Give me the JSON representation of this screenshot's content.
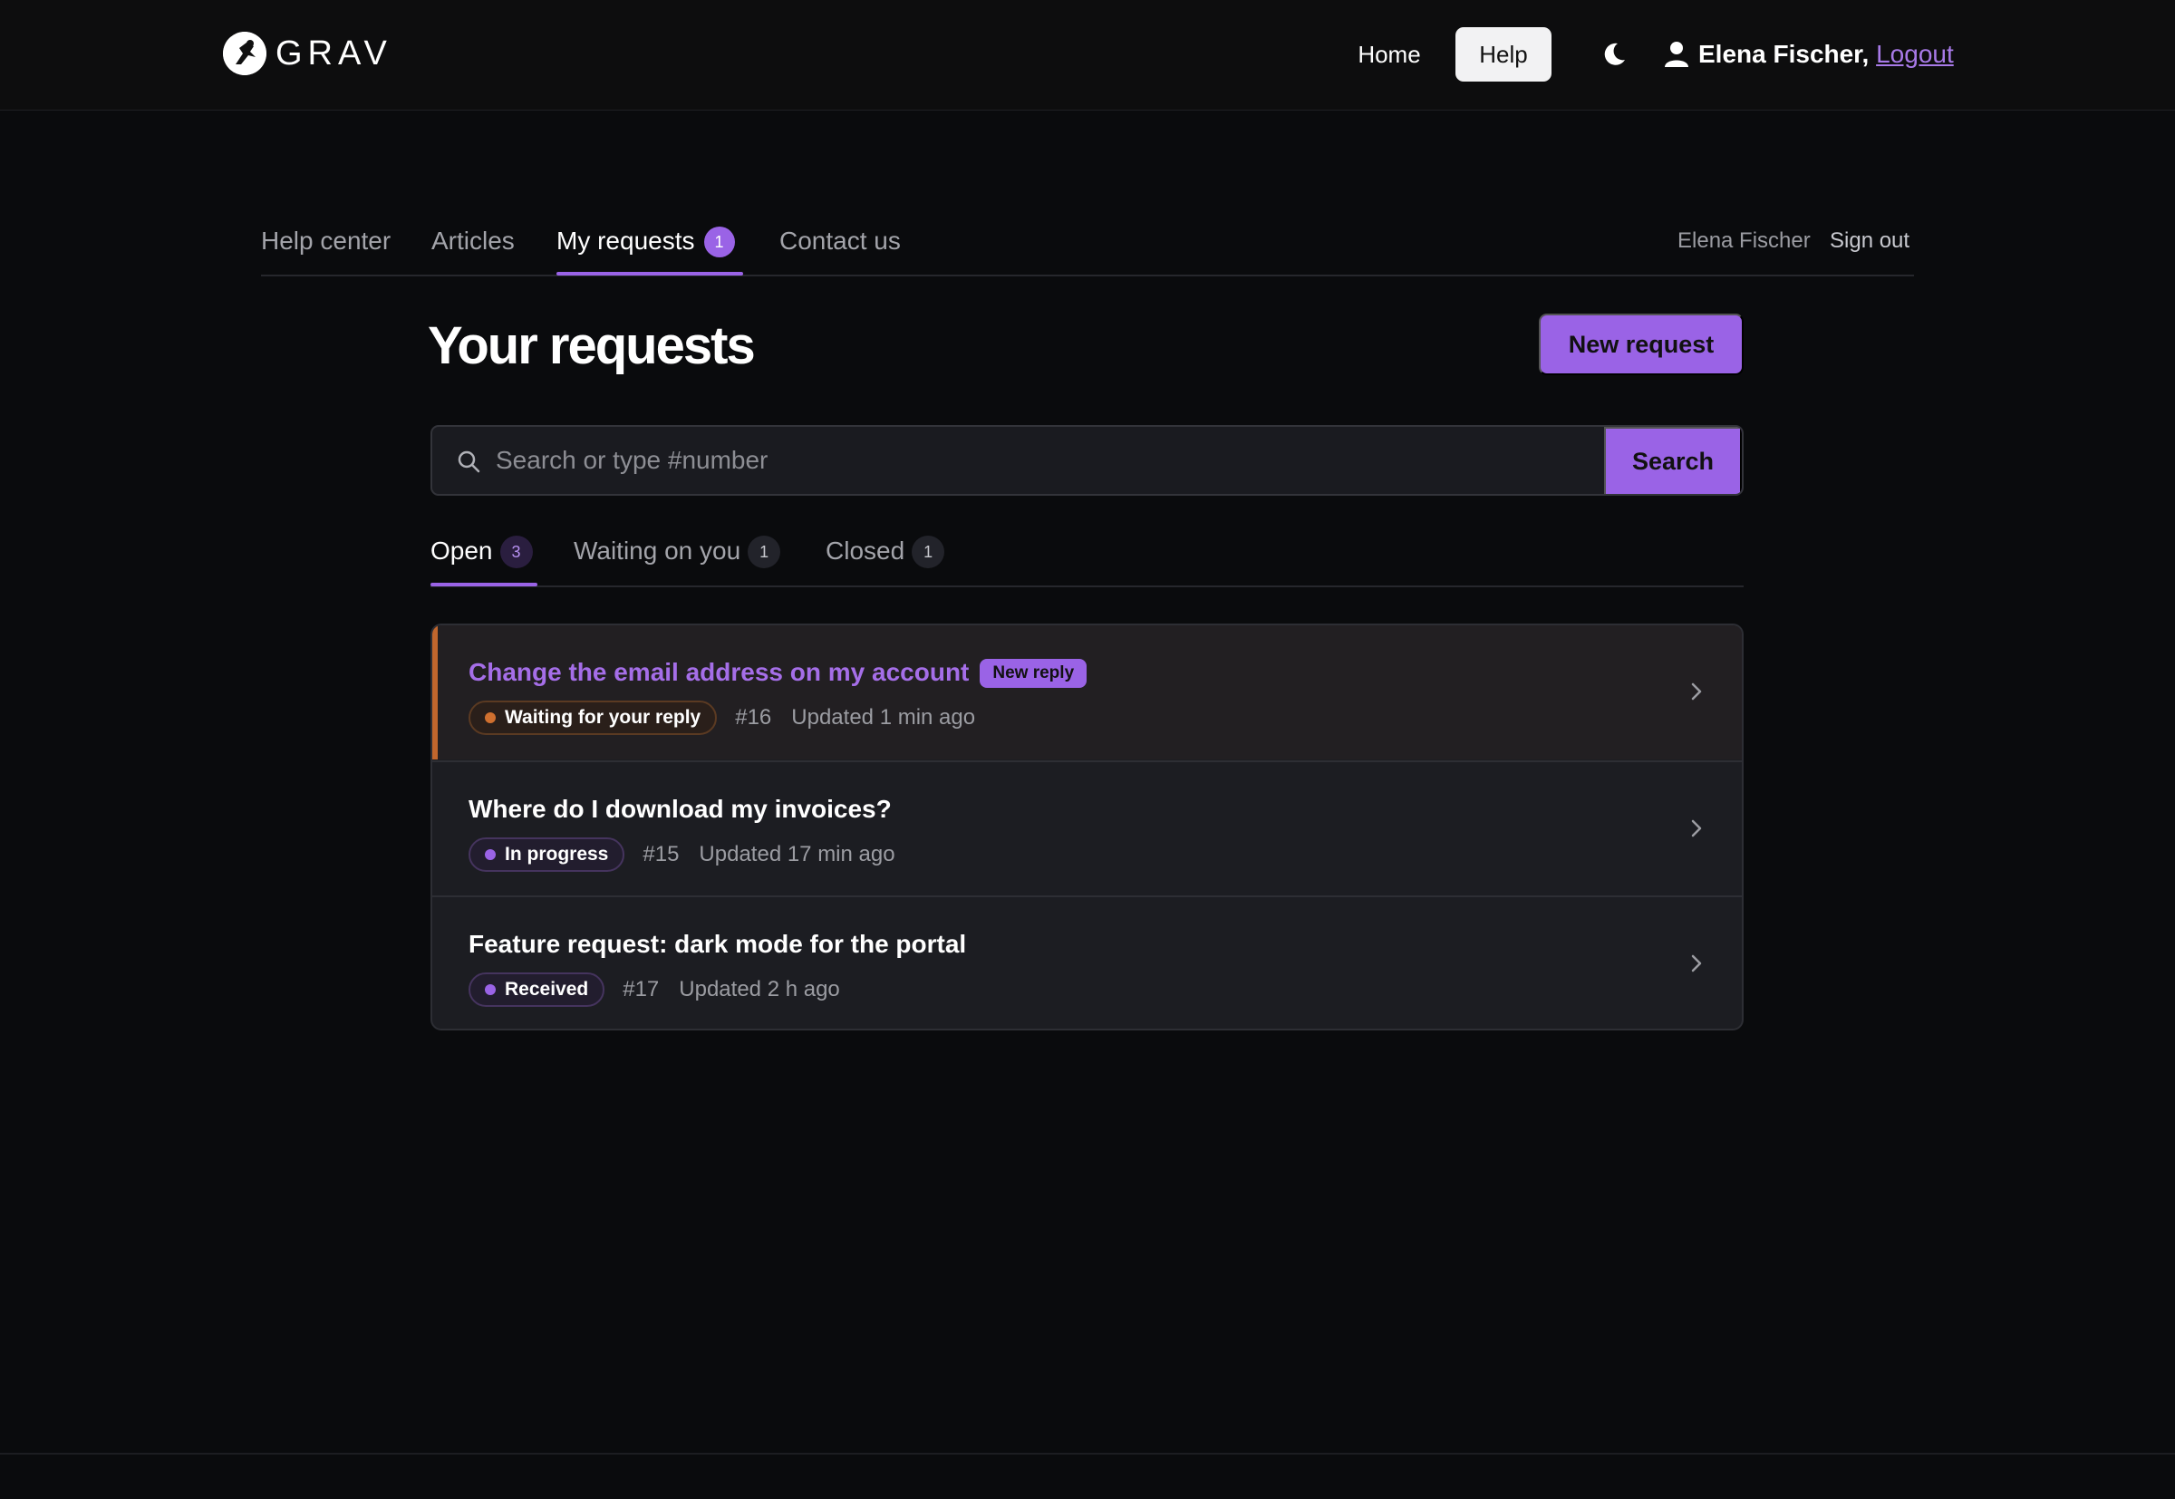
{
  "header": {
    "logo_text": "GRAV",
    "nav": {
      "home": "Home",
      "help": "Help"
    },
    "user_name": "Elena Fischer,",
    "logout": "Logout"
  },
  "subnav": {
    "items": [
      {
        "label": "Help center"
      },
      {
        "label": "Articles"
      },
      {
        "label": "My requests",
        "badge": "1"
      },
      {
        "label": "Contact us"
      }
    ],
    "right_name": "Elena Fischer",
    "sign_out": "Sign out"
  },
  "main": {
    "title": "Your requests",
    "new_request": "New request",
    "search": {
      "placeholder": "Search or type #number",
      "button": "Search"
    },
    "tabs": [
      {
        "label": "Open",
        "count": "3"
      },
      {
        "label": "Waiting on you",
        "count": "1"
      },
      {
        "label": "Closed",
        "count": "1"
      }
    ],
    "requests": [
      {
        "title": "Change the email address on my account",
        "tag": "New reply",
        "status": "Waiting for your reply",
        "number": "#16",
        "updated": "Updated 1 min ago"
      },
      {
        "title": "Where do I download my invoices?",
        "status": "In progress",
        "number": "#15",
        "updated": "Updated 17 min ago"
      },
      {
        "title": "Feature request: dark mode for the portal",
        "status": "Received",
        "number": "#17",
        "updated": "Updated 2 h ago"
      }
    ]
  },
  "colors": {
    "accent": "#9a63e6",
    "waiting": "#d0702f",
    "background": "#0a0b0d"
  },
  "icons": [
    "logo-icon",
    "moon-icon",
    "user-icon",
    "search-icon",
    "chevron-right-icon"
  ]
}
